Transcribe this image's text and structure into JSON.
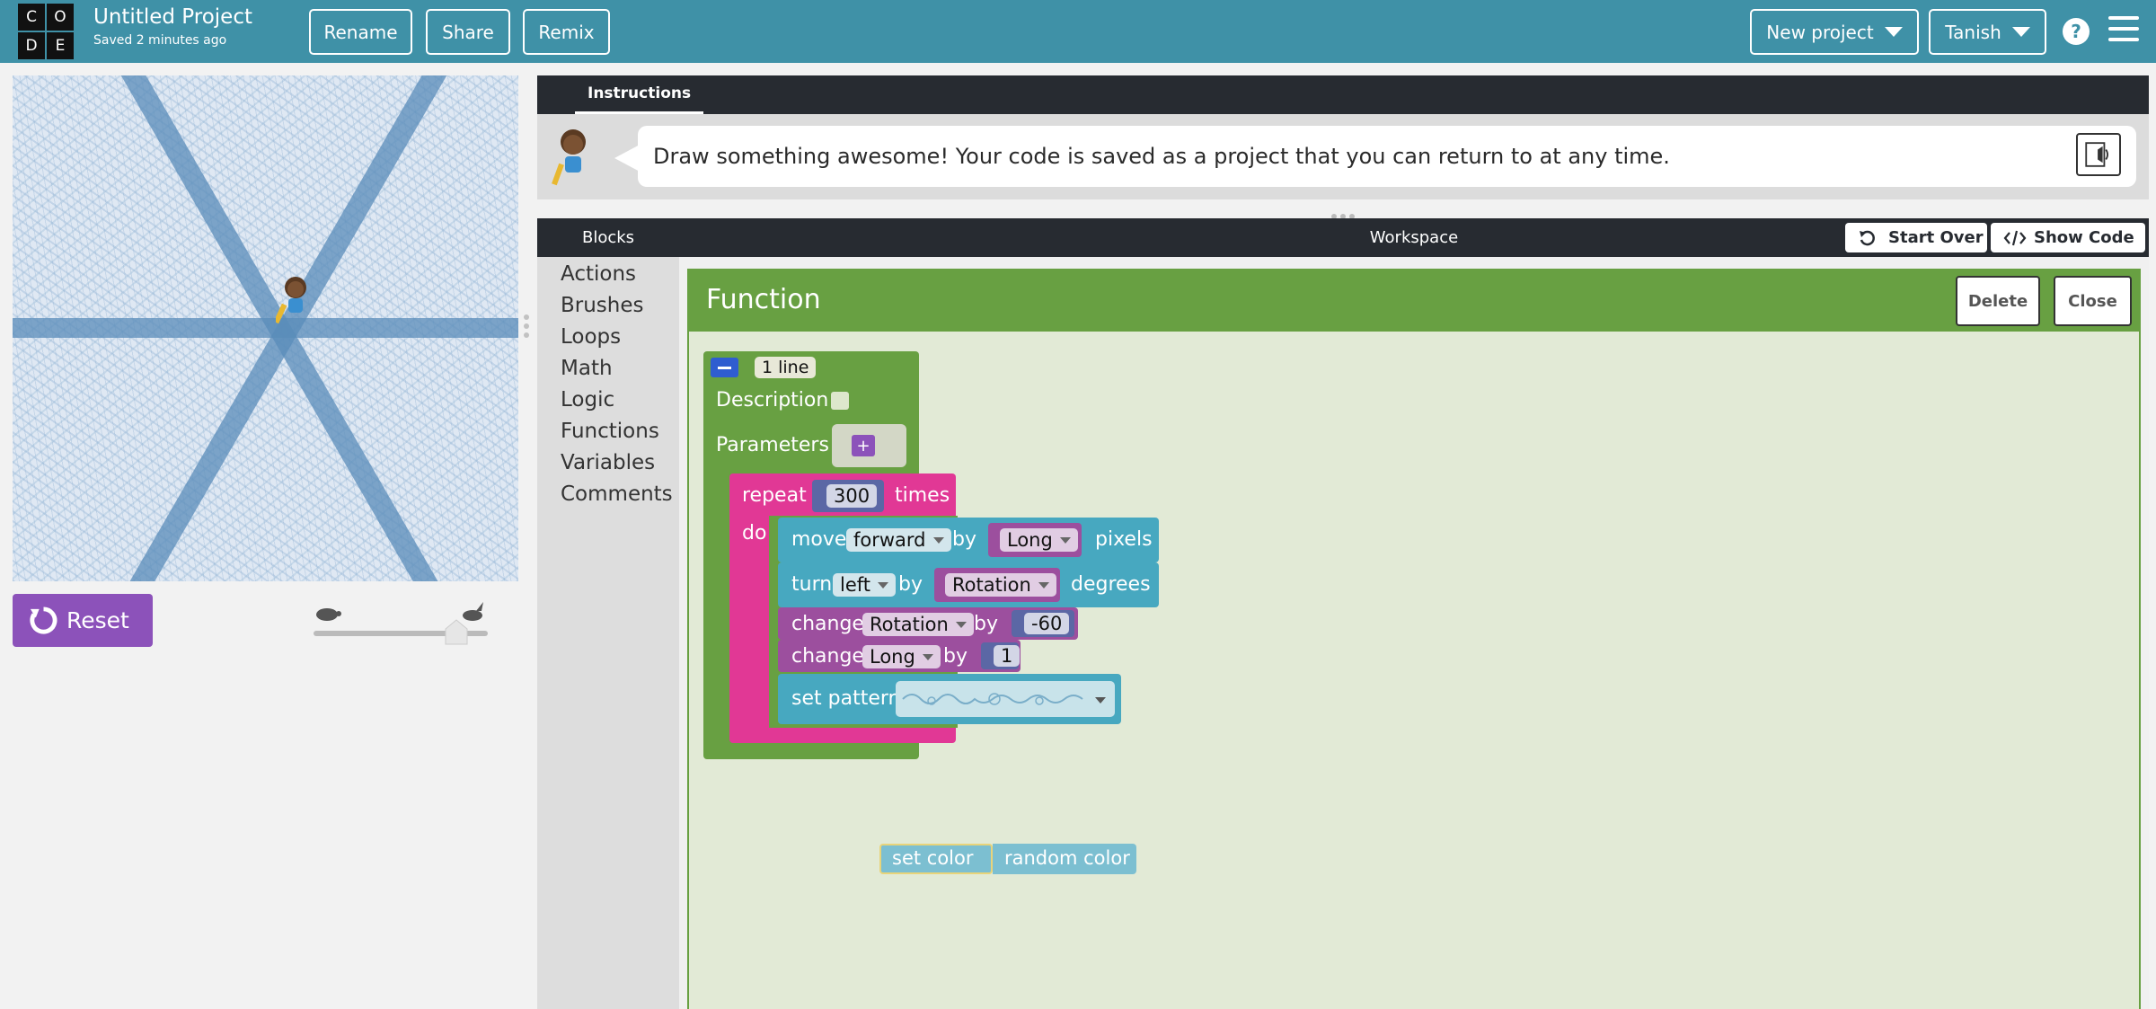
{
  "header": {
    "logo_letters": [
      "C",
      "O",
      "D",
      "E"
    ],
    "project_title": "Untitled Project",
    "saved_status": "Saved 2 minutes ago",
    "rename_label": "Rename",
    "share_label": "Share",
    "remix_label": "Remix",
    "new_project_label": "New project",
    "user_label": "Tanish",
    "help_label": "?",
    "bg_color": "#3f91a7"
  },
  "visualization": {
    "reset_label": "Reset",
    "reset_color": "#8c52ba"
  },
  "instructions": {
    "tab_label": "Instructions",
    "text": "Draw something awesome! Your code is saved as a project that you can return to at any time."
  },
  "workspace": {
    "blocks_header": "Blocks",
    "title": "Workspace",
    "start_over_label": "Start Over",
    "show_code_label": "Show Code"
  },
  "toolbox": {
    "categories": [
      "Actions",
      "Brushes",
      "Loops",
      "Math",
      "Logic",
      "Functions",
      "Variables",
      "Comments"
    ]
  },
  "function_editor": {
    "title": "Function",
    "delete_label": "Delete",
    "close_label": "Close",
    "collapse_label": "1 line",
    "description_label": "Description",
    "parameters_label": "Parameters",
    "add_param_label": "+",
    "header_color": "#68a042"
  },
  "blocks": {
    "repeat": {
      "label": "repeat",
      "count": "300",
      "times_label": "times",
      "do_label": "do",
      "color": "#e13895"
    },
    "move": {
      "label": "move",
      "direction": "forward",
      "by_label": "by",
      "variable": "Long",
      "unit_label": "pixels",
      "color": "#47a8c0"
    },
    "turn": {
      "label": "turn",
      "direction": "left",
      "by_label": "by",
      "variable": "Rotation",
      "unit_label": "degrees"
    },
    "change_rotation": {
      "label": "change",
      "variable": "Rotation",
      "by_label": "by",
      "value": "-60"
    },
    "change_long": {
      "label": "change",
      "variable": "Long",
      "by_label": "by",
      "value": "1"
    },
    "set_pattern": {
      "label": "set pattern"
    },
    "set_color": {
      "label": "set color",
      "value": "random color"
    }
  }
}
